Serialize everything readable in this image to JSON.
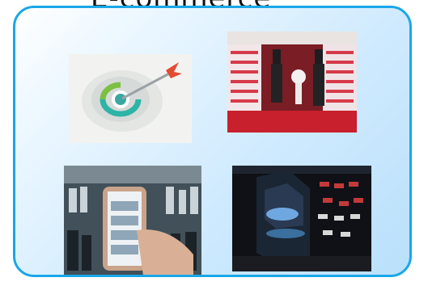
{
  "slide": {
    "title": "E-commerce"
  },
  "images": [
    {
      "icon": "target-icon"
    },
    {
      "icon": "store-photo-icon"
    },
    {
      "icon": "phone-shopping-icon"
    },
    {
      "icon": "shoe-display-icon"
    }
  ]
}
